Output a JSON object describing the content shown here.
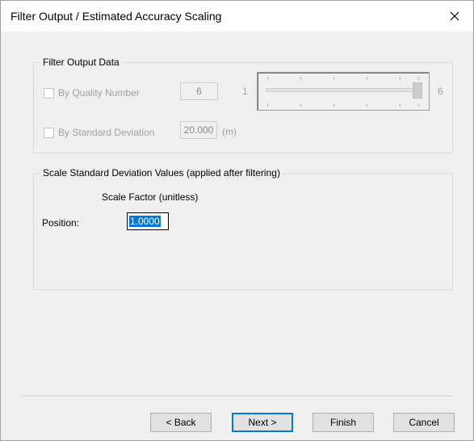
{
  "window": {
    "title": "Filter Output / Estimated Accuracy Scaling",
    "close_icon": "close-icon"
  },
  "filter_group": {
    "legend": "Filter Output Data",
    "quality": {
      "label": "By Quality Number",
      "checked": false,
      "enabled": false,
      "value": "6",
      "slider_min_label": "1",
      "slider_max_label": "6",
      "slider_value": 6,
      "slider_min": 1,
      "slider_max": 6
    },
    "stddev": {
      "label": "By Standard Deviation",
      "checked": false,
      "enabled": false,
      "value": "20.000",
      "unit": "(m)"
    }
  },
  "scale_group": {
    "legend": "Scale Standard Deviation Values (applied after filtering)",
    "column_header": "Scale Factor (unitless)",
    "position_label": "Position:",
    "position_value": "1.0000"
  },
  "buttons": {
    "back": "< Back",
    "next": "Next >",
    "finish": "Finish",
    "cancel": "Cancel"
  }
}
